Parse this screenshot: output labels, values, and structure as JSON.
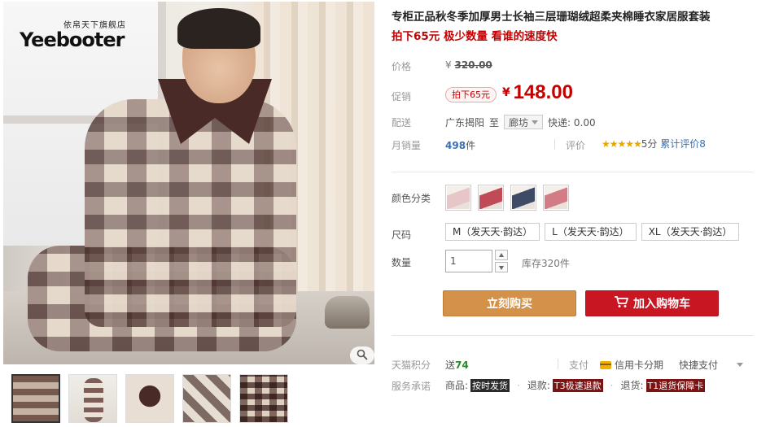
{
  "brand": {
    "logo_top": "依帛天下旗舰店",
    "logo_main": "Yeebooter"
  },
  "product": {
    "title": "专柜正品秋冬季加厚男士长袖三层珊瑚绒超柔夹棉睡衣家居服套装",
    "subtitle": "拍下65元 极少数量 看谁的速度快"
  },
  "price": {
    "label": "价格",
    "currency": "¥",
    "original": "320.00"
  },
  "promo": {
    "label": "促销",
    "badge": "拍下65元",
    "currency": "¥",
    "price": "148.00"
  },
  "shipping": {
    "label": "配送",
    "from": "广东揭阳",
    "to_word": "至",
    "destination": "廊坊",
    "fee": "快递: 0.00"
  },
  "sales": {
    "label": "月销量",
    "count": "498",
    "unit": "件",
    "review_label": "评价",
    "stars": "★★★★★",
    "score": "5分",
    "cumulative": "累计评价8"
  },
  "color": {
    "label": "颜色分类",
    "swatches": [
      {
        "name": "pink-plaid",
        "color": "#e7c6c9"
      },
      {
        "name": "red-plaid",
        "color": "#c04a55"
      },
      {
        "name": "navy-plaid",
        "color": "#3e4a66"
      },
      {
        "name": "rose-plaid",
        "color": "#d27c86"
      }
    ]
  },
  "size": {
    "label": "尺码",
    "options": [
      "M（发天天·韵达）",
      "L（发天天·韵达）",
      "XL（发天天·韵达）"
    ]
  },
  "quantity": {
    "label": "数量",
    "value": "1",
    "stock": "库存320件"
  },
  "actions": {
    "buy": "立刻购买",
    "cart": "加入购物车"
  },
  "points": {
    "label": "天猫积分",
    "prefix": "送",
    "value": "74"
  },
  "payment": {
    "label": "支付",
    "card": "信用卡分期",
    "quick": "快捷支付"
  },
  "service": {
    "label": "服务承诺",
    "items": [
      {
        "prefix": "商品:",
        "tag": "按时发货"
      },
      {
        "prefix": "退款:",
        "tag": "T3极速退款"
      },
      {
        "prefix": "退货:",
        "tag": "T1退货保障卡"
      }
    ]
  },
  "icons": {
    "zoom": "magnifier-icon",
    "cart": "cart-icon",
    "card": "credit-card-icon",
    "caret": "chevron-down-icon"
  },
  "colors": {
    "accent_red": "#c40000",
    "buy_button": "#d4914a",
    "cart_button": "#c81623"
  }
}
